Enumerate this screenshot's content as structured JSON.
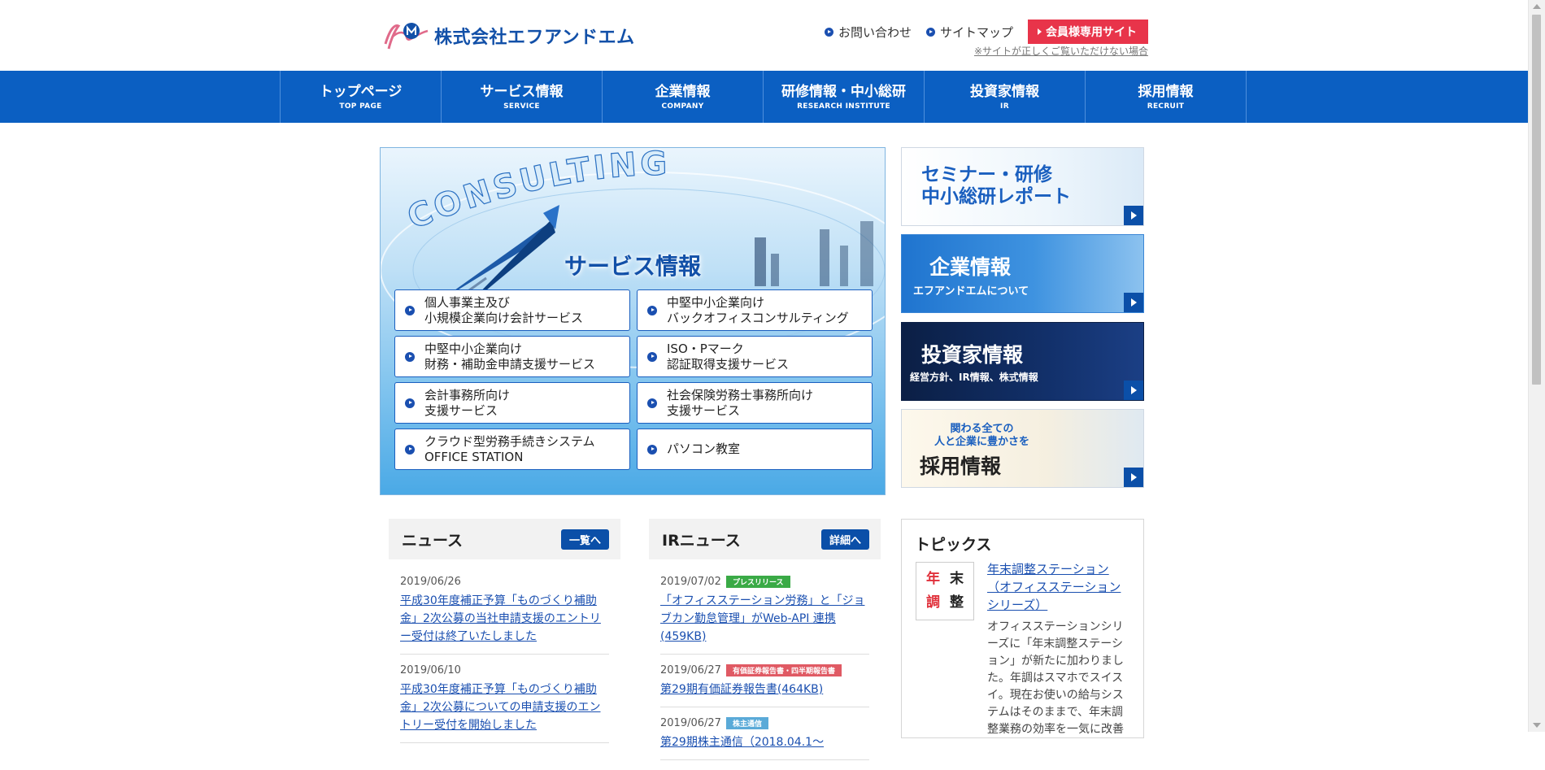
{
  "header": {
    "company_name": "株式会社エフアンドエム",
    "links": [
      {
        "label": "お問い合わせ"
      },
      {
        "label": "サイトマップ"
      }
    ],
    "member_button": "会員様専用サイト",
    "note": "※サイトが正しくご覧いただけない場合"
  },
  "nav": {
    "items": [
      {
        "ja": "トップページ",
        "en": "TOP PAGE"
      },
      {
        "ja": "サービス情報",
        "en": "SERVICE"
      },
      {
        "ja": "企業情報",
        "en": "COMPANY"
      },
      {
        "ja": "研修情報・中小総研",
        "en": "RESEARCH INSTITUTE"
      },
      {
        "ja": "投資家情報",
        "en": "IR"
      },
      {
        "ja": "採用情報",
        "en": "RECRUIT"
      }
    ]
  },
  "hero": {
    "watermark": "CONSULTING",
    "title": "サービス情報",
    "services": [
      {
        "line1": "個人事業主及び",
        "line2": "小規模企業向け会計サービス"
      },
      {
        "line1": "中堅中小企業向け",
        "line2": "バックオフィスコンサルティング"
      },
      {
        "line1": "中堅中小企業向け",
        "line2": "財務・補助金申請支援サービス"
      },
      {
        "line1": "ISO・Pマーク",
        "line2": "認証取得支援サービス"
      },
      {
        "line1": "会計事務所向け",
        "line2": "支援サービス"
      },
      {
        "line1": "社会保険労務士事務所向け",
        "line2": "支援サービス"
      },
      {
        "line1": "クラウド型労務手続きシステム",
        "line2": "OFFICE STATION"
      },
      {
        "line1": "パソコン教室",
        "line2": ""
      }
    ]
  },
  "banners": {
    "seminar": {
      "line1": "セミナー・研修",
      "line2": "中小総研レポート"
    },
    "company": {
      "title": "企業情報",
      "sub": "エフアンドエムについて"
    },
    "investor": {
      "title": "投資家情報",
      "sub": "経営方針、IR情報、株式情報"
    },
    "recruit": {
      "line1": "関わる全ての",
      "line2": "人と企業に豊かさを",
      "title": "採用情報"
    }
  },
  "news": {
    "title": "ニュース",
    "more": "一覧へ",
    "items": [
      {
        "date": "2019/06/26",
        "text": "平成30年度補正予算「ものづくり補助金」2次公募の当社申請支援のエントリー受付は終了いたしました"
      },
      {
        "date": "2019/06/10",
        "text": "平成30年度補正予算「ものづくり補助金」2次公募についての申請支援のエントリー受付を開始しました"
      }
    ]
  },
  "ir_news": {
    "title": "IRニュース",
    "more": "詳細へ",
    "items": [
      {
        "date": "2019/07/02",
        "tag": "プレスリリース",
        "text": "「オフィスステーション労務」と「ジョブカン勤怠管理」がWeb-API 連携(459KB)"
      },
      {
        "date": "2019/06/27",
        "tag": "有価証券報告書・四半期報告書",
        "text": "第29期有価証券報告書(464KB)"
      },
      {
        "date": "2019/06/27",
        "tag": "株主通信",
        "text": "第29期株主通信（2018.04.1～"
      }
    ]
  },
  "topics": {
    "title": "トピックス",
    "thumb_chars": [
      "年",
      "末",
      "調",
      "整"
    ],
    "item_title": "年末調整ステーション（オフィスステーションシリーズ）",
    "item_body": "オフィスステーションシリーズに「年末調整ステーション」が新たに加わりました。年調はスマホでスイスイ。現在お使いの給与システムはそのままで、年末調整業務の効率を一気に改善"
  }
}
